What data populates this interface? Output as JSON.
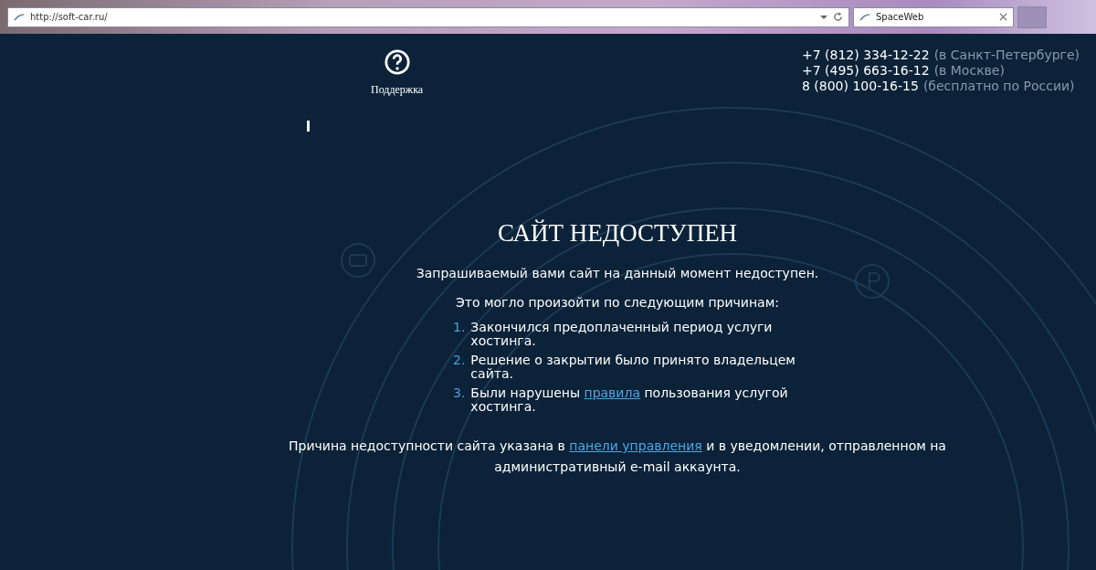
{
  "browser": {
    "address": "http://soft-car.ru/",
    "tab": {
      "title": "SpaceWeb",
      "selected": true
    }
  },
  "support": {
    "label": "Поддержка"
  },
  "phones": [
    {
      "number": "+7 (812) 334-12-22",
      "note": "(в Санкт-Петербурге)"
    },
    {
      "number": "+7 (495) 663-16-12",
      "note": "(в Москве)"
    },
    {
      "number": "8 (800) 100-16-15",
      "note": "(бесплатно по России)"
    }
  ],
  "title": "САЙТ НЕДОСТУПЕН",
  "intro": "Запрашиваемый вами сайт на данный момент недоступен.",
  "reasons_heading": "Это могло произойти по следующим причинам:",
  "reasons": [
    {
      "number": "1.",
      "parts": [
        {
          "text": "Закончился предоплаченный период услуги хостинга."
        }
      ]
    },
    {
      "number": "2.",
      "parts": [
        {
          "text": "Решение о закрытии было принято владельцем сайта."
        }
      ]
    },
    {
      "number": "3.",
      "parts": [
        {
          "text": "Были нарушены "
        },
        {
          "text": "правила",
          "link": true
        },
        {
          "text": " пользования услугой хостинга."
        }
      ]
    }
  ],
  "footer": {
    "parts": [
      {
        "text": "Причина недоступности сайта указана в "
      },
      {
        "text": "панели управления",
        "link": true
      },
      {
        "text": " и в уведомлении, отправленном на административный e-mail аккаунта."
      }
    ]
  }
}
